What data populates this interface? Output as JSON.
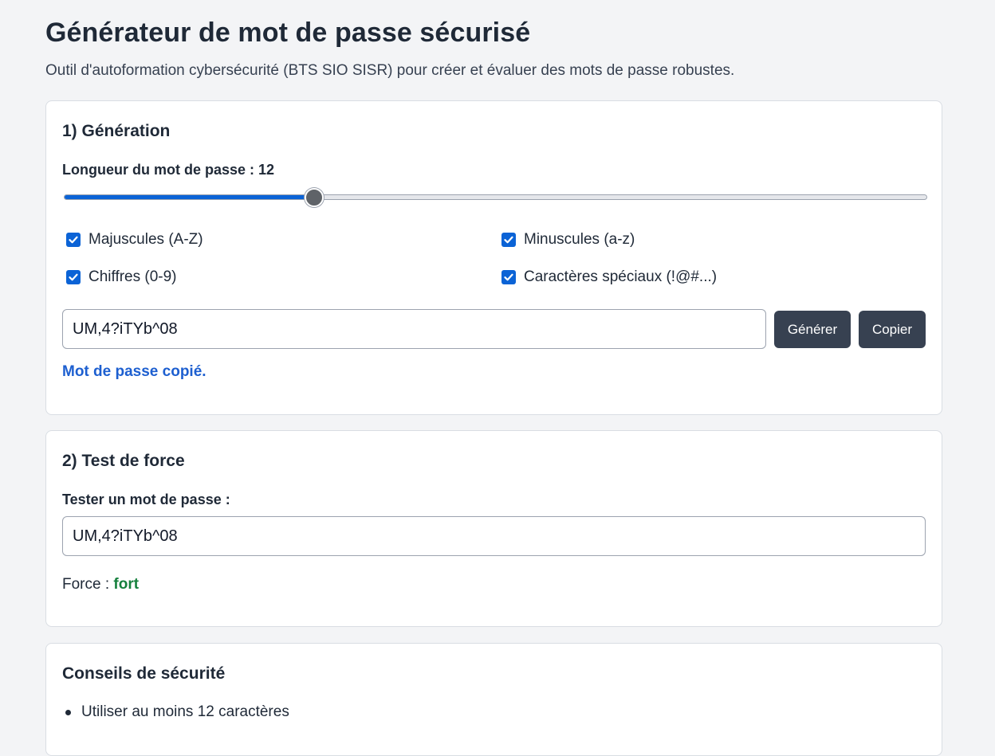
{
  "header": {
    "title": "Générateur de mot de passe sécurisé",
    "subtitle": "Outil d'autoformation cybersécurité (BTS SIO SISR) pour créer et évaluer des mots de passe robustes."
  },
  "generation": {
    "heading": "1) Génération",
    "length_label": "Longueur du mot de passe : 12",
    "length_value": 12,
    "length_slider_fraction": 0.29,
    "options": [
      {
        "label": "Majuscules (A-Z)",
        "checked": true
      },
      {
        "label": "Minuscules (a-z)",
        "checked": true
      },
      {
        "label": "Chiffres (0-9)",
        "checked": true
      },
      {
        "label": "Caractères spéciaux (!@#...)",
        "checked": true
      }
    ],
    "password_value": "UM,4?iTYb^08",
    "generate_label": "Générer",
    "copy_label": "Copier",
    "copy_notice": "Mot de passe copié."
  },
  "strength": {
    "heading": "2) Test de force",
    "test_label": "Tester un mot de passe :",
    "test_value": "UM,4?iTYb^08",
    "force_label": "Force : ",
    "force_value": "fort"
  },
  "tips": {
    "heading": "Conseils de sécurité",
    "items": [
      "Utiliser au moins 12 caractères"
    ]
  },
  "colors": {
    "accent": "#0b63d6",
    "button": "#374151",
    "notice": "#1d5fd0",
    "strong": "#15803d",
    "background": "#f3f4f6"
  }
}
